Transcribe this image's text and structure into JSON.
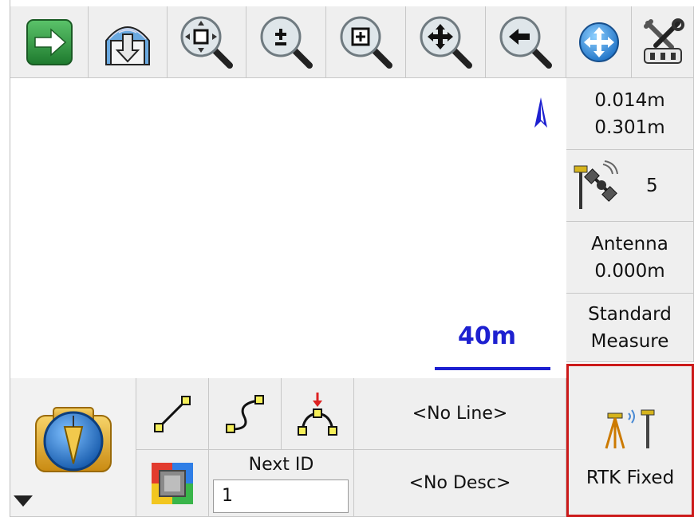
{
  "toolbar": {
    "buttons": [
      {
        "name": "forward-button",
        "icon": "green-arrow-right-icon"
      },
      {
        "name": "import-button",
        "icon": "globe-download-icon"
      },
      {
        "name": "zoom-extents-button",
        "icon": "zoom-extents-icon"
      },
      {
        "name": "zoom-in-out-button",
        "icon": "zoom-plus-minus-icon"
      },
      {
        "name": "zoom-window-button",
        "icon": "zoom-window-icon"
      },
      {
        "name": "pan-button",
        "icon": "zoom-pan-icon"
      },
      {
        "name": "zoom-previous-button",
        "icon": "zoom-back-icon"
      },
      {
        "name": "map-view-button",
        "icon": "globe-arrows-icon"
      },
      {
        "name": "tools-button",
        "icon": "wrench-screwdriver-icon"
      }
    ]
  },
  "status": {
    "precision_h": "0.014m",
    "precision_v": "0.301m",
    "satellites": "5",
    "antenna_label": "Antenna",
    "antenna_value": "0.000m",
    "mode_line1": "Standard",
    "mode_line2": "Measure",
    "rtk_label": "RTK Fixed"
  },
  "map": {
    "scale_label": "40m",
    "north_icon": "north-arrow-icon"
  },
  "bottom": {
    "line_label": "<No Line>",
    "desc_label": "<No Desc>",
    "next_id_label": "Next ID",
    "next_id_value": "1"
  },
  "colors": {
    "accent_blue": "#1d20d0",
    "rtk_border": "#cc1a1a",
    "button_bg": "#efefef"
  }
}
